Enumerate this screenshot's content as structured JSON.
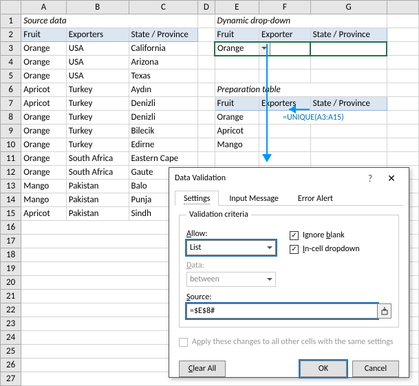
{
  "cols": [
    "A",
    "B",
    "C",
    "D",
    "E",
    "F",
    "G"
  ],
  "source_title": "Source data",
  "dynamic_title": "Dynamic drop-down",
  "prep_title": "Preparation table",
  "h": {
    "fruit": "Fruit",
    "exporters": "Exporters",
    "state": "State / Province",
    "exporter": "Exporter"
  },
  "source": [
    {
      "a": "Orange",
      "b": "USA",
      "c": "California"
    },
    {
      "a": "Orange",
      "b": "USA",
      "c": "Arizona"
    },
    {
      "a": "Orange",
      "b": "USA",
      "c": "Texas"
    },
    {
      "a": "Apricot",
      "b": "Turkey",
      "c": "Aydın"
    },
    {
      "a": "Apricot",
      "b": "Turkey",
      "c": "Denizli"
    },
    {
      "a": "Orange",
      "b": "Turkey",
      "c": "Denizli"
    },
    {
      "a": "Orange",
      "b": "Turkey",
      "c": "Bilecik"
    },
    {
      "a": "Orange",
      "b": "Turkey",
      "c": "Edirne"
    },
    {
      "a": "Orange",
      "b": "South Africa",
      "c": "Eastern Cape"
    },
    {
      "a": "Orange",
      "b": "South Africa",
      "c": "Gaute"
    },
    {
      "a": "Mango",
      "b": "Pakistan",
      "c": "Balo"
    },
    {
      "a": "Mango",
      "b": "Pakistan",
      "c": "Punja"
    },
    {
      "a": "Apricot",
      "b": "Pakistan",
      "c": "Sindh"
    }
  ],
  "dd_value": "Orange",
  "prep": [
    "Orange",
    "Apricot",
    "Mango"
  ],
  "formula_hint": "=UNIQUE(A3:A15)",
  "dialog": {
    "title": "Data Validation",
    "tabs": {
      "settings": "Settings",
      "input": "Input Message",
      "error": "Error Alert"
    },
    "criteria_legend": "Validation criteria",
    "allow_label": "Allow:",
    "allow_value": "List",
    "data_label": "Data:",
    "data_value": "between",
    "source_label": "Source:",
    "source_value": "=$E$8#",
    "ignore_blank": "Ignore blank",
    "incell": "In-cell dropdown",
    "apply": "Apply these changes to all other cells with the same settings",
    "clear": "Clear All",
    "ok": "OK",
    "cancel": "Cancel"
  },
  "chart_data": {
    "type": "table",
    "title": "Source data",
    "columns": [
      "Fruit",
      "Exporters",
      "State / Province"
    ],
    "rows": [
      [
        "Orange",
        "USA",
        "California"
      ],
      [
        "Orange",
        "USA",
        "Arizona"
      ],
      [
        "Orange",
        "USA",
        "Texas"
      ],
      [
        "Apricot",
        "Turkey",
        "Aydın"
      ],
      [
        "Apricot",
        "Turkey",
        "Denizli"
      ],
      [
        "Orange",
        "Turkey",
        "Denizli"
      ],
      [
        "Orange",
        "Turkey",
        "Bilecik"
      ],
      [
        "Orange",
        "Turkey",
        "Edirne"
      ],
      [
        "Orange",
        "South Africa",
        "Eastern Cape"
      ],
      [
        "Orange",
        "South Africa",
        "Gauteng"
      ],
      [
        "Mango",
        "Pakistan",
        "Balochistan"
      ],
      [
        "Mango",
        "Pakistan",
        "Punjab"
      ],
      [
        "Apricot",
        "Pakistan",
        "Sindh"
      ]
    ],
    "preparation_unique": [
      "Orange",
      "Apricot",
      "Mango"
    ],
    "preparation_formula": "=UNIQUE(A3:A15)",
    "dropdown_source_formula": "=$E$8#"
  }
}
